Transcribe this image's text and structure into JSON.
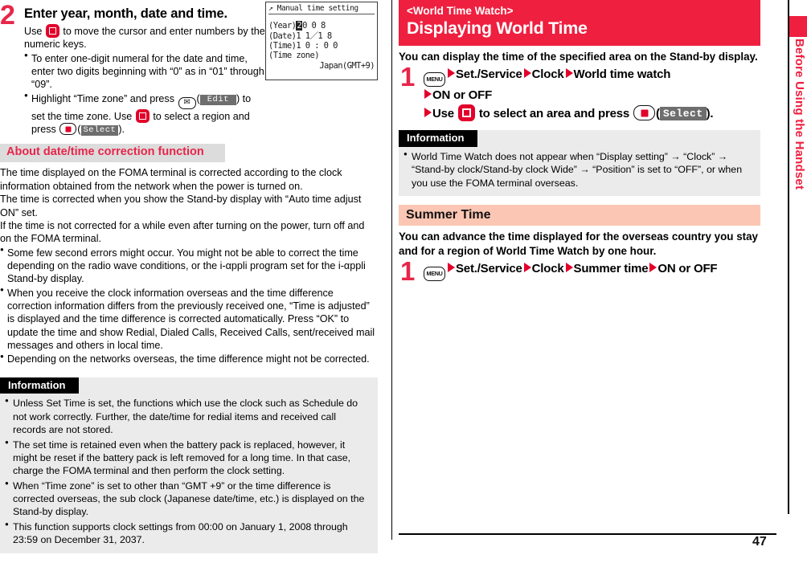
{
  "page": {
    "number": "47",
    "side_tab_label": "Before Using the Handset"
  },
  "left_column": {
    "step": {
      "number": "2",
      "title": "Enter year, month, date and time.",
      "intro_a": "Use",
      "intro_b": "to move the cursor and enter numbers by the numeric keys.",
      "bullets": [
        {
          "text": "To enter one-digit numeral for the date and time, enter two digits beginning with “0” as in “01” through “09”."
        },
        {
          "part1": "Highlight “Time zone” and press",
          "chip1": "Edit",
          "part2": ") to set the time zone. Use",
          "part3": "to select a region and press",
          "chip2": "Select",
          "part4": ")."
        }
      ]
    },
    "phone_screen": {
      "title": "Manual time setting",
      "year_label": "(Year)",
      "year_selected": "2",
      "year_rest": "0 0 8",
      "date_label": "(Date)",
      "date_value": "1 1／1 8",
      "time_label": "(Time)",
      "time_value": "1 0 : 0 0",
      "zone_label": "(Time zone)",
      "zone_value": "Japan(GMT+9)"
    },
    "section_heading": "About date/time correction function",
    "paragraphs": [
      "The time displayed on the FOMA terminal is corrected according to the clock information obtained from the network when the power is turned on.",
      "The time is corrected when you show the Stand-by display with “Auto time adjust ON” set.",
      "If the time is not corrected for a while even after turning on the power, turn off and on the FOMA terminal."
    ],
    "bullets": [
      "Some few second errors might occur. You might not be able to correct the time depending on the radio wave conditions, or the i-αppli program set for the i-αppli Stand-by display.",
      "When you receive the clock information overseas and the time difference correction information differs from the previously received one, “Time is adjusted” is displayed and the time difference is corrected automatically. Press “OK” to update the time and show Redial, Dialed Calls, Received Calls, sent/received mail messages and others in local time.",
      "Depending on the networks overseas, the time difference might not be corrected."
    ],
    "information": {
      "heading": "Information",
      "items": [
        "Unless Set Time is set, the functions which use the clock such as Schedule do not work correctly. Further, the date/time for redial items and received call records are not stored.",
        "The set time is retained even when the battery pack is replaced, however, it might be reset if the battery pack is left removed for a long time. In that case, charge the FOMA terminal and then perform the clock setting.",
        "When “Time zone” is set to other than “GMT +9” or the time difference is corrected overseas, the sub clock (Japanese date/time, etc.) is displayed on the Stand-by display.",
        "This function supports clock settings from 00:00 on January 1, 2008 through 23:59 on December 31, 2037."
      ]
    }
  },
  "right_column": {
    "title_bar": {
      "kicker": "<World Time Watch>",
      "heading": "Displaying World Time"
    },
    "lead": "You can display the time of the specified area on the Stand-by display.",
    "step1": {
      "number": "1",
      "menu_key": "MENU",
      "item1": "Set./Service",
      "item2": "Clock",
      "item3": "World time watch",
      "item4": "ON or OFF",
      "line3_a": "Use",
      "line3_b": "to select an area and press",
      "chip": "Select",
      "line3_c": ")."
    },
    "information": {
      "heading": "Information",
      "items": [
        "World Time Watch does not appear when “Display setting” → “Clock” → “Stand-by clock/Stand-by clock Wide” → “Position” is set to “OFF”, or when you use the FOMA terminal overseas."
      ]
    },
    "summer_time": {
      "heading": "Summer Time",
      "lead": "You can advance the time displayed for the overseas country you stay and for a region of World Time Watch by one hour.",
      "step": {
        "number": "1",
        "menu_key": "MENU",
        "item1": "Set./Service",
        "item2": "Clock",
        "item3": "Summer time",
        "item4": "ON or OFF"
      }
    }
  },
  "colors": {
    "brand_red": "#ef1f3f",
    "heading_red": "#e8254a",
    "key_red": "#e2002b",
    "peach": "#fbc7b4",
    "gray_bar": "#dcdcdc",
    "info_bg": "#ebebeb"
  }
}
